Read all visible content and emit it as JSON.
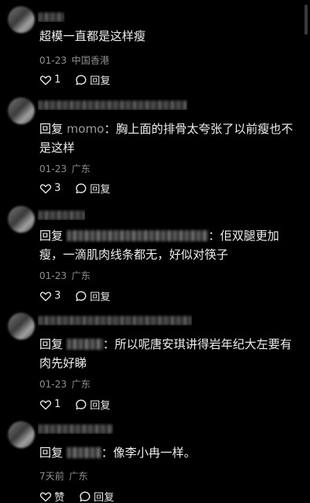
{
  "comments": [
    {
      "username": "",
      "reply_prefix": "",
      "mention": "",
      "content": "超模一直都是这样瘦",
      "date": "01-23",
      "location": "中国香港",
      "like_count": "1",
      "reply_label": "回复"
    },
    {
      "username": "",
      "reply_prefix": "回复 ",
      "mention": "momo",
      "content": "：胸上面的排骨太夸张了以前瘦也不是这样",
      "date": "01-23",
      "location": "广东",
      "like_count": "3",
      "reply_label": "回复"
    },
    {
      "username": "",
      "reply_prefix": "回复 ",
      "mention": "",
      "content": "：佢双腿更加瘦，一滴肌肉线条都无，好似对筷子",
      "date": "01-23",
      "location": "广东",
      "like_count": "3",
      "reply_label": "回复"
    },
    {
      "username": "",
      "reply_prefix": "回复 ",
      "mention": "",
      "content": "：所以呢唐安琪讲得岩年纪大左要有肉先好睇",
      "date": "01-23",
      "location": "广东",
      "like_count": "1",
      "reply_label": "回复"
    },
    {
      "username": "",
      "reply_prefix": "回复 ",
      "mention": "",
      "content": "：像李小冉一样。",
      "date": "7天前",
      "location": "广东",
      "like_count": "赞",
      "reply_label": "回复"
    }
  ]
}
